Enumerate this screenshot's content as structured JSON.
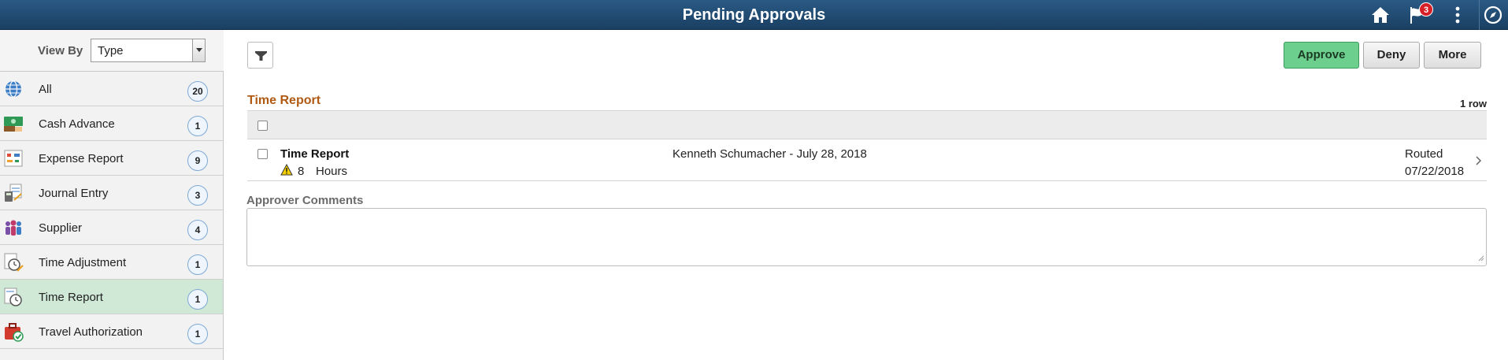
{
  "header": {
    "title": "Pending Approvals",
    "notification_count": "3"
  },
  "sidebar": {
    "viewby_label": "View By",
    "viewby_value": "Type",
    "items": [
      {
        "label": "All",
        "count": "20",
        "icon": "globe-icon",
        "active": false
      },
      {
        "label": "Cash Advance",
        "count": "1",
        "icon": "cash-advance-icon",
        "active": false
      },
      {
        "label": "Expense Report",
        "count": "9",
        "icon": "expense-report-icon",
        "active": false
      },
      {
        "label": "Journal Entry",
        "count": "3",
        "icon": "journal-entry-icon",
        "active": false
      },
      {
        "label": "Supplier",
        "count": "4",
        "icon": "supplier-icon",
        "active": false
      },
      {
        "label": "Time Adjustment",
        "count": "1",
        "icon": "time-adjustment-icon",
        "active": false
      },
      {
        "label": "Time Report",
        "count": "1",
        "icon": "time-report-icon",
        "active": true
      },
      {
        "label": "Travel Authorization",
        "count": "1",
        "icon": "travel-authorization-icon",
        "active": false
      }
    ]
  },
  "toolbar": {
    "approve_label": "Approve",
    "deny_label": "Deny",
    "more_label": "More"
  },
  "main": {
    "section_title": "Time Report",
    "row_count": "1 row",
    "rows": [
      {
        "title": "Time Report",
        "quantity": "8",
        "unit": "Hours",
        "person": "Kenneth Schumacher - July 28, 2018",
        "status": "Routed",
        "date": "07/22/2018"
      }
    ],
    "comments_label": "Approver Comments",
    "comments_value": ""
  },
  "colors": {
    "header": "#1f4a70",
    "accent_orange": "#b05a13",
    "approve_green": "#6ccf8d",
    "active_row": "#cfe9d6"
  }
}
